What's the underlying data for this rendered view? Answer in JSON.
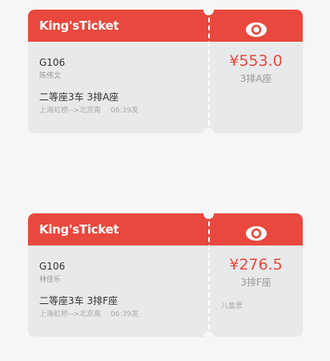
{
  "tickets": [
    {
      "brand": "King'sTicket",
      "train": "G106",
      "passenger": "陈伟文",
      "seat_info": "二等座3车 3排A座",
      "route": "上海虹桥-->北京南",
      "time": "06:39发",
      "price": "¥553.0",
      "seat_short": "3排A座",
      "ticket_type": "",
      "icon": "eye-icon"
    },
    {
      "brand": "King'sTicket",
      "train": "G106",
      "passenger": "林佳乐",
      "seat_info": "二等座3车 3排F座",
      "route": "上海虹桥-->北京南",
      "time": "06:39发",
      "price": "¥276.5",
      "seat_short": "3排F座",
      "ticket_type": "儿童票",
      "icon": "eye-icon"
    }
  ],
  "colors": {
    "accent": "#e8483e",
    "card_bg": "#e8e9ea",
    "page_bg": "#f6f6f6"
  }
}
